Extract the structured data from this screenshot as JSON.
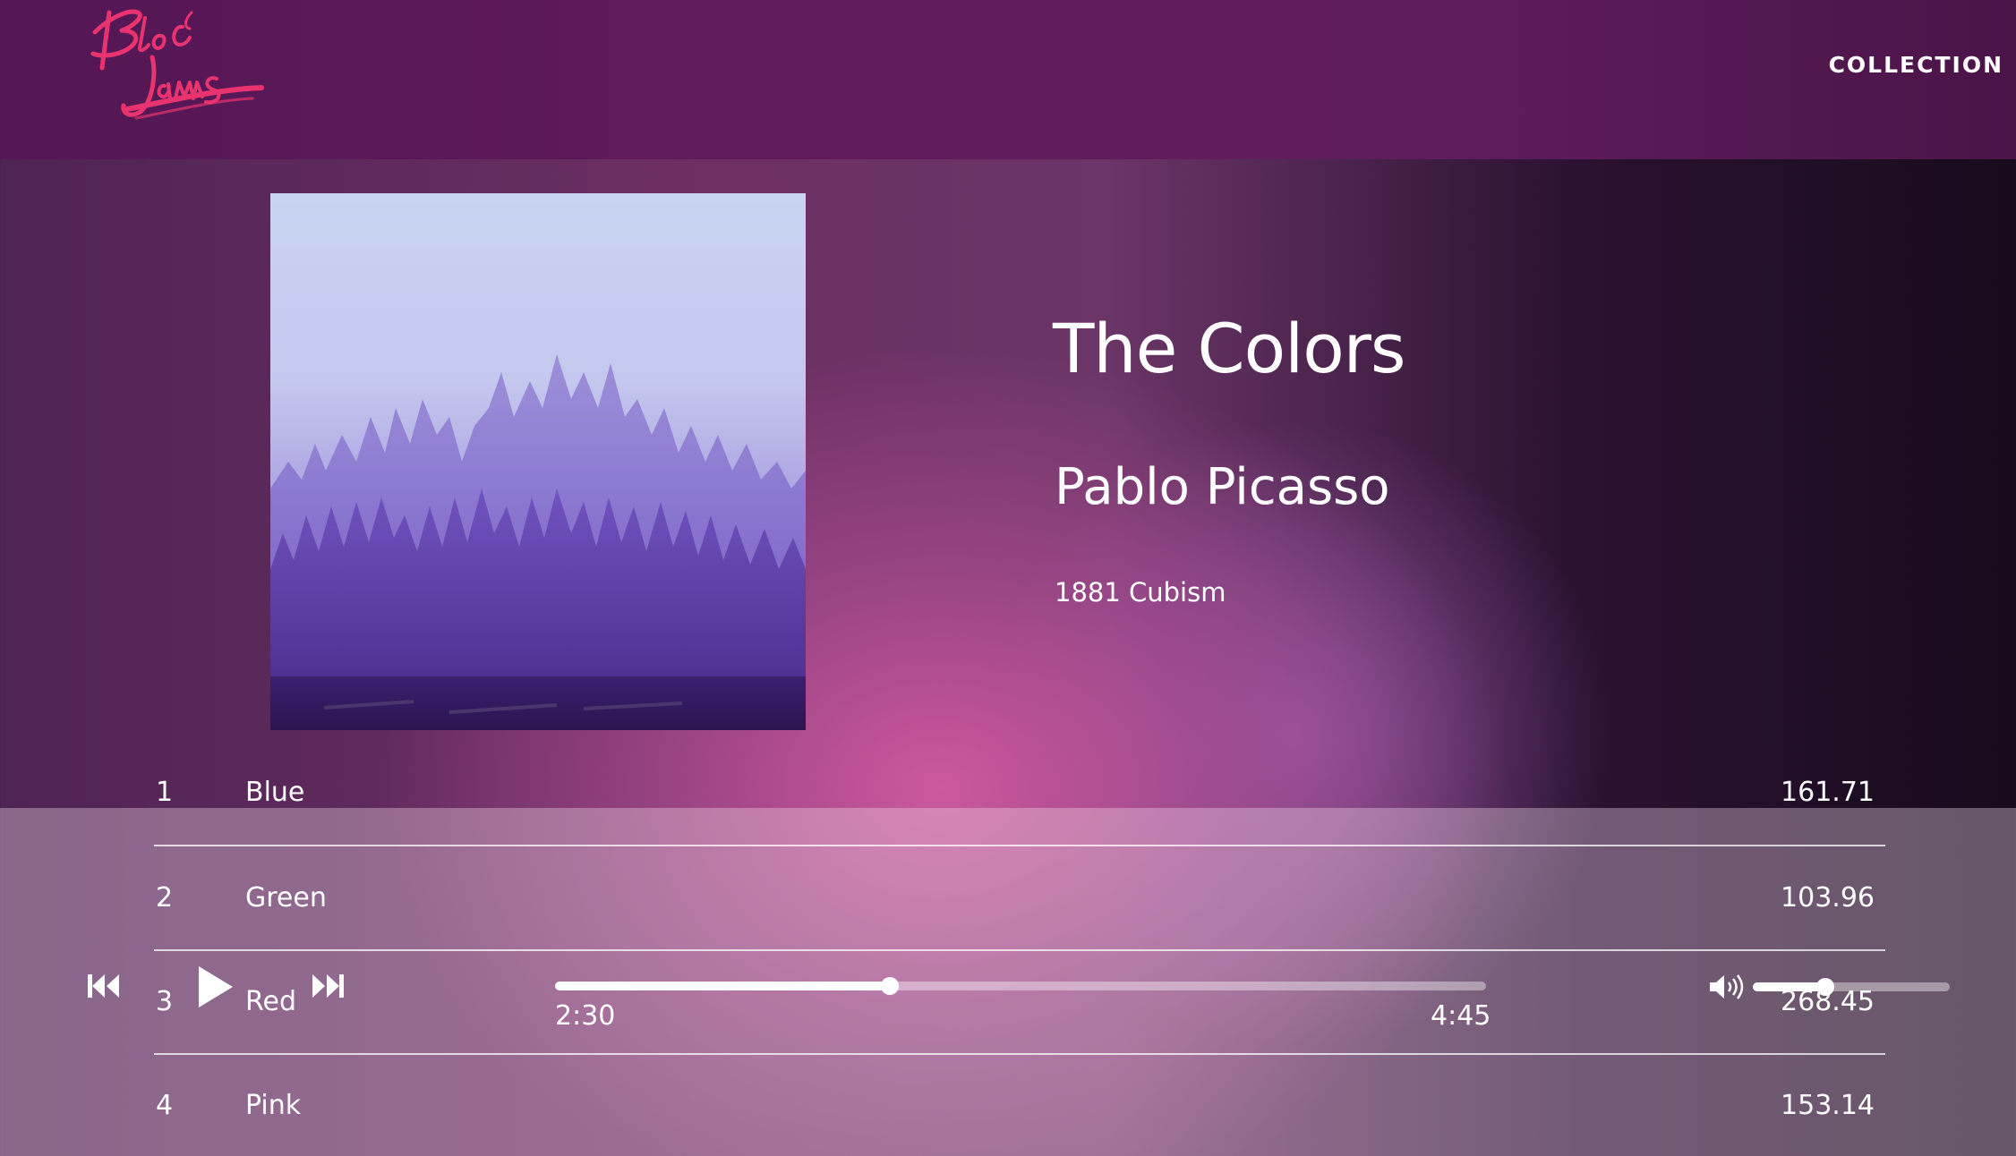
{
  "header": {
    "logo_alt": "Bloc Jams",
    "nav": {
      "collection_label": "COLLECTION"
    }
  },
  "album": {
    "title": "The Colors",
    "artist": "Pablo Picasso",
    "release_info": "1881 Cubism"
  },
  "songs": [
    {
      "number": "1",
      "title": "Blue",
      "duration": "161.71"
    },
    {
      "number": "2",
      "title": "Green",
      "duration": "103.96"
    },
    {
      "number": "3",
      "title": "Red",
      "duration": "268.45"
    },
    {
      "number": "4",
      "title": "Pink",
      "duration": "153.14"
    }
  ],
  "player": {
    "current_time": "2:30",
    "total_time": "4:45",
    "seek_progress": 0.36,
    "volume_level": 0.37,
    "icons": {
      "previous": "previous-track-icon",
      "play": "play-icon",
      "next": "next-track-icon",
      "volume": "volume-icon"
    }
  },
  "colors": {
    "header_bg": "#5f1a5b",
    "logo_pink": "#e8336e",
    "accent_pink": "#c85a9a"
  }
}
